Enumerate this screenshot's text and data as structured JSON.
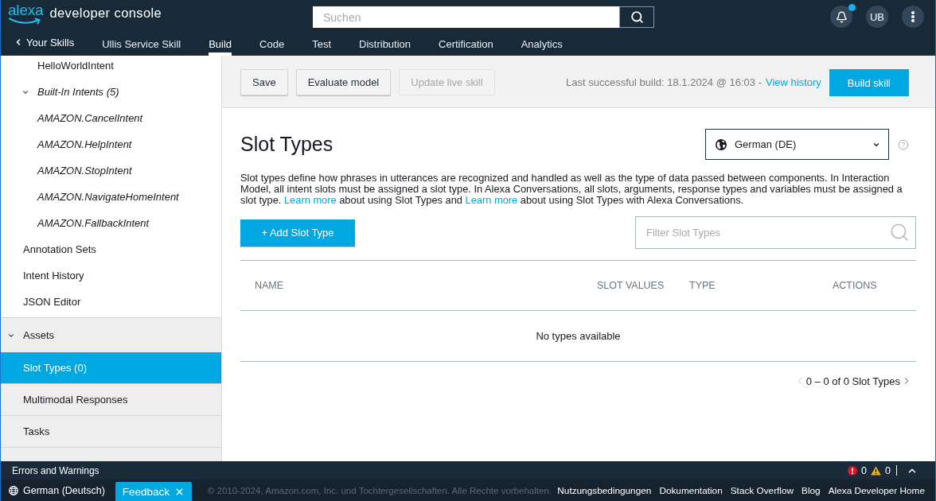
{
  "header": {
    "logo": "alexa",
    "product": "developer console",
    "search": {
      "placeholder": "Suchen"
    },
    "notifications": {
      "unread": true
    },
    "avatar": "UB"
  },
  "nav": {
    "back": "Your Skills",
    "tabs": [
      {
        "label": "Ullis Service Skill",
        "selected": false
      },
      {
        "label": "Build",
        "selected": true
      },
      {
        "label": "Code",
        "selected": false
      },
      {
        "label": "Test",
        "selected": false
      },
      {
        "label": "Distribution",
        "selected": false
      },
      {
        "label": "Certification",
        "selected": false
      },
      {
        "label": "Analytics",
        "selected": false
      }
    ]
  },
  "sidebar": {
    "intents": [
      {
        "label": "HelloWorldIntent",
        "selected": false
      },
      {
        "label": "Built-In Intents (5)",
        "selected": false,
        "expanded": true,
        "children": [
          {
            "label": "AMAZON.CancelIntent",
            "selected": false
          },
          {
            "label": "AMAZON.HelpIntent",
            "selected": false
          },
          {
            "label": "AMAZON.StopIntent",
            "selected": false
          },
          {
            "label": "AMAZON.NavigateHomeIntent",
            "selected": false
          },
          {
            "label": "AMAZON.FallbackIntent",
            "selected": false
          }
        ]
      }
    ],
    "links": [
      {
        "label": "Annotation Sets",
        "selected": false
      },
      {
        "label": "Intent History",
        "selected": false
      },
      {
        "label": "JSON Editor",
        "selected": false
      }
    ],
    "sections": [
      {
        "label": "Assets",
        "expanded": true,
        "children": [
          {
            "label": "Slot Types (0)",
            "selected": true
          },
          {
            "label": "Multimodal Responses",
            "selected": false
          },
          {
            "label": "Tasks",
            "selected": false
          }
        ]
      }
    ]
  },
  "toolbar": {
    "buttons": [
      {
        "label": "Save",
        "disabled": false
      },
      {
        "label": "Evaluate model",
        "disabled": false
      },
      {
        "label": "Update live skill",
        "disabled": true
      }
    ],
    "build_status": "Last successful build: 18.1.2024 @ 16:03 -",
    "history_link": "View history",
    "build_button": "Build skill"
  },
  "page": {
    "title": "Slot Types",
    "locale": "German (DE)",
    "description": [
      {
        "kind": "text",
        "text": "Slot types define how phrases in utterances are recognized and handled as well as the type of data passed between components. In Interaction Model, all intent slots must be assigned a slot type. In Alexa Conversations, all slots, arguments, response types and variables must be assigned a slot type. "
      },
      {
        "kind": "link",
        "text": "Learn more"
      },
      {
        "kind": "text",
        "text": " about using Slot Types and "
      },
      {
        "kind": "link",
        "text": "Learn more"
      },
      {
        "kind": "text",
        "text": " about using Slot Types with Alexa Conversations."
      }
    ],
    "add_button": "+ Add Slot Type",
    "filter": {
      "placeholder": "Filter Slot Types"
    }
  },
  "table": {
    "columns": [
      "NAME",
      "SLOT VALUES",
      "TYPE",
      "ACTIONS"
    ],
    "empty_message": "No types available",
    "pagination": {
      "label": "0 – 0 of 0 Slot Types",
      "prev": {
        "disabled": true
      },
      "next": {
        "disabled": false
      }
    }
  },
  "errors_bar": {
    "label": "Errors and Warnings",
    "errors": "0",
    "warnings": "0"
  },
  "bottom_bar": {
    "language": "German (Deutsch)",
    "feedback": "Feedback",
    "copyright": "© 2010-2024, Amazon.com, Inc. und Tochtergesellschaften. Alle Rechte vorbehalten.",
    "links": [
      "Nutzungsbedingungen",
      "Dokumentation",
      "Stack Overflow",
      "Blog",
      "Alexa Developer Home"
    ]
  }
}
